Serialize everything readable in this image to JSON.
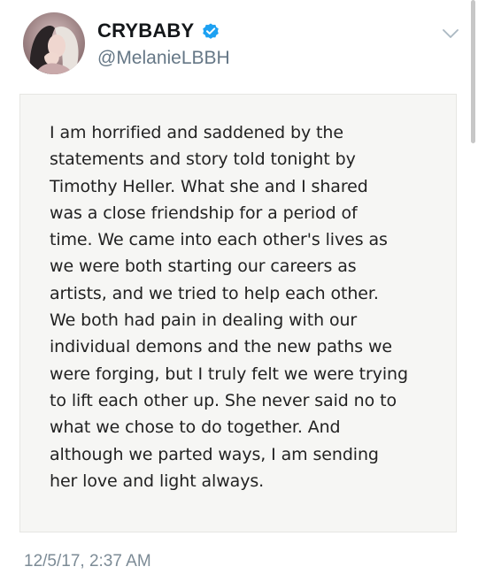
{
  "tweet": {
    "display_name": "CRYBABY",
    "handle": "@MelanieLBBH",
    "verified": true,
    "timestamp": "12/5/17, 2:37 AM"
  },
  "note": {
    "lines": [
      "I am horrified and saddened by the",
      "statements and story told tonight by",
      "Timothy Heller.  What she and I shared",
      "was a close friendship for a period of",
      "time.  We came into each other's lives as",
      "we were both starting our careers as",
      "artists, and we tried to help each other.",
      "We both had pain in dealing with our",
      "individual demons and the new paths we",
      "were forging, but I truly felt we were trying",
      "to lift each other up.  She never said no to",
      "what we chose to do together. And",
      "although we parted ways, I am sending",
      "her love and light always."
    ]
  },
  "icons": {
    "verified": "verified-badge-icon",
    "menu": "chevron-down-icon",
    "avatar": "profile-photo"
  },
  "colors": {
    "verified_blue": "#1da1f2",
    "handle_gray": "#657786",
    "timestamp_gray": "#7c8b96",
    "note_background": "#f6f6f4"
  }
}
